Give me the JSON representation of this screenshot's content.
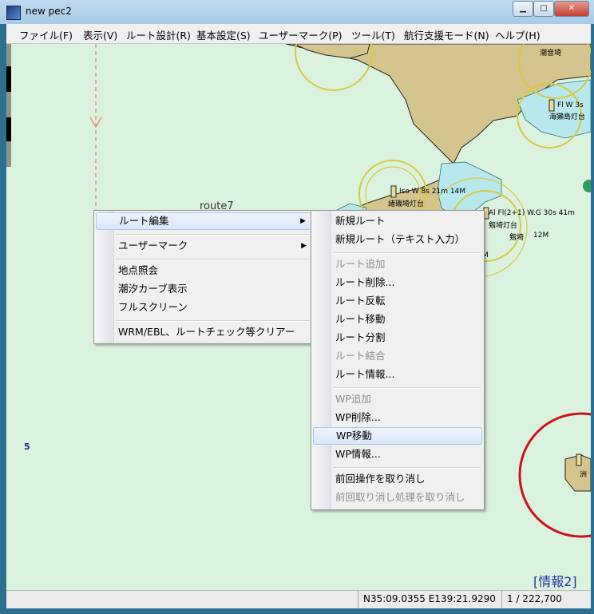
{
  "window": {
    "title": "new pec2",
    "min_icon": "minimize-icon",
    "max_icon": "maximize-icon",
    "close_icon": "close-icon"
  },
  "menubar": [
    "ファイル(F)",
    "表示(V)",
    "ルート設計(R)",
    "基本設定(S)",
    "ユーザーマーク(P)",
    "ツール(T)",
    "航行支援モード(N)",
    "ヘルプ(H)"
  ],
  "map": {
    "route_label": "route7",
    "scale_label": "5",
    "info_link": "[情報2]",
    "labels": [
      "潮音埼",
      "Fl W 3s",
      "海獺島灯台",
      "Iso W 8s 21m 14M",
      "諸磯埼灯台",
      "Al Fl(2+1) W.G 30s 41m",
      "剱埼灯台",
      "12M",
      "剱埼",
      "M",
      "洲"
    ]
  },
  "context_menu": {
    "items": [
      {
        "label": "ルート編集",
        "submenu": true
      },
      {
        "label": "ユーザーマーク",
        "submenu": true
      },
      {
        "label": "地点照会"
      },
      {
        "label": "潮汐カーブ表示"
      },
      {
        "label": "フルスクリーン"
      },
      {
        "label": "WRM/EBL、ルートチェック等クリアー"
      }
    ]
  },
  "submenu": {
    "items": [
      {
        "label": "新規ルート",
        "enabled": true
      },
      {
        "label": "新規ルート（テキスト入力）",
        "enabled": true
      },
      {
        "label": "ルート追加",
        "enabled": false
      },
      {
        "label": "ルート削除...",
        "enabled": true
      },
      {
        "label": "ルート反転",
        "enabled": true
      },
      {
        "label": "ルート移動",
        "enabled": true
      },
      {
        "label": "ルート分割",
        "enabled": true
      },
      {
        "label": "ルート結合",
        "enabled": false
      },
      {
        "label": "ルート情報...",
        "enabled": true
      },
      {
        "label": "WP追加",
        "enabled": false
      },
      {
        "label": "WP削除...",
        "enabled": true
      },
      {
        "label": "WP移動",
        "enabled": true,
        "highlighted": true
      },
      {
        "label": "WP情報...",
        "enabled": true
      },
      {
        "label": "前回操作を取り消し",
        "enabled": true
      },
      {
        "label": "前回取り消し処理を取り消し",
        "enabled": false
      }
    ]
  },
  "status": {
    "coords": "N35:09.0355 E139:21.9290",
    "scale": "1 / 222,700"
  },
  "colors": {
    "sea": "#dbf2df",
    "land": "#d4c58f",
    "shallow": "#b8e8ec",
    "light_ring": "#d9c844",
    "red_ring": "#c8141c"
  }
}
